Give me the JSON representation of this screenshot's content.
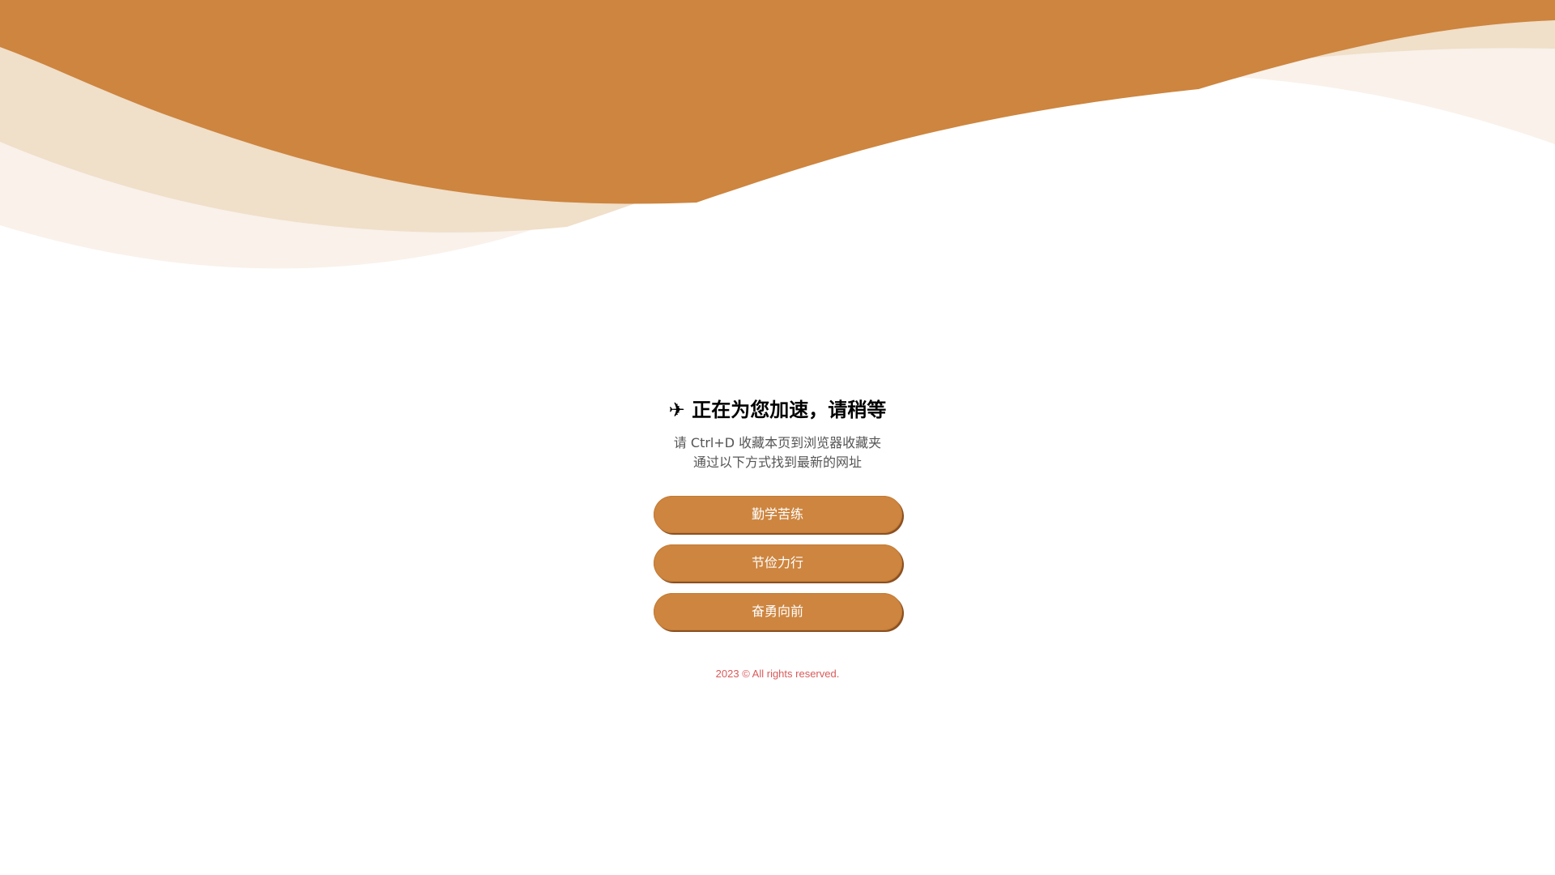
{
  "header": {
    "icon": "airplane-icon",
    "icon_glyph": "✈",
    "title": "正在为您加速，请稍等"
  },
  "subtitle": {
    "line1": "请 Ctrl+D 收藏本页到浏览器收藏夹",
    "line2": "通过以下方式找到最新的网址"
  },
  "buttons": [
    {
      "label": "勤学苦练"
    },
    {
      "label": "节俭力行"
    },
    {
      "label": "奋勇向前"
    }
  ],
  "footer": {
    "text": "2023 © All rights reserved."
  },
  "colors": {
    "accent": "#cd853f",
    "wave_light": "#f0dfc9",
    "wave_lighter": "#f9f1ea",
    "footer_text": "#d95a5a"
  }
}
